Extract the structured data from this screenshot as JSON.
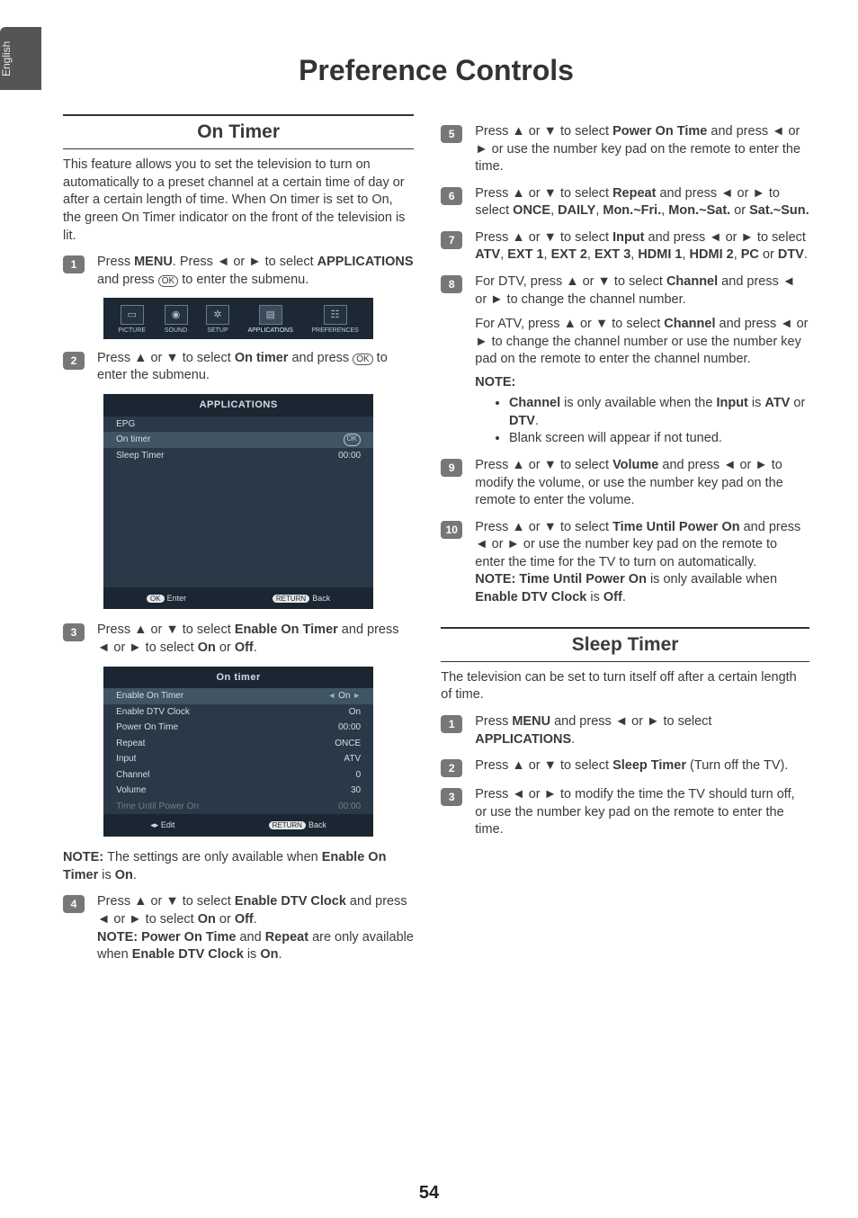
{
  "sideTab": "English",
  "pageTitle": "Preference Controls",
  "pageNumber": "54",
  "left": {
    "section": "On Timer",
    "intro": "This feature allows you to set the television to turn on automatically to a preset channel at a certain time of day or after a certain length of time. When On timer is set to On, the green On Timer indicator on the front of the television is lit.",
    "step1": {
      "pre": "Press ",
      "b1": "MENU",
      "mid1": ". Press ◄ or ► to select ",
      "b2": "APPLICATIONS",
      "mid2": " and press ",
      "ok": "OK",
      "post": " to enter the submenu."
    },
    "menubar": {
      "items": [
        "PICTURE",
        "SOUND",
        "SETUP",
        "APPLICATIONS",
        "PREFERENCES"
      ],
      "glyphs": [
        "▭",
        "◉",
        "✲",
        "▤",
        "☷"
      ]
    },
    "step2": {
      "pre": "Press ▲ or ▼ to select ",
      "b1": "On timer",
      "mid": " and press ",
      "ok": "OK",
      "post": " to enter the submenu."
    },
    "osd1": {
      "title": "APPLICATIONS",
      "rows": [
        {
          "k": "EPG",
          "v": ""
        },
        {
          "k": "On timer",
          "v": "OK",
          "sel": true
        },
        {
          "k": "Sleep Timer",
          "v": "00:00"
        }
      ],
      "footL": "Enter",
      "footLBtn": "OK",
      "footR": "Back",
      "footRBtn": "RETURN"
    },
    "step3": {
      "pre": "Press ▲ or ▼ to select ",
      "b1": "Enable On Timer",
      "mid": " and press ◄ or ► to select ",
      "b2": "On",
      "or": " or ",
      "b3": "Off",
      "post": "."
    },
    "osd2": {
      "title": "On timer",
      "rows": [
        {
          "k": "Enable On Timer",
          "v": "On",
          "sel": true,
          "arrows": true
        },
        {
          "k": "Enable DTV Clock",
          "v": "On"
        },
        {
          "k": "Power On Time",
          "v": "00:00"
        },
        {
          "k": "Repeat",
          "v": "ONCE"
        },
        {
          "k": "Input",
          "v": "ATV"
        },
        {
          "k": "Channel",
          "v": "0"
        },
        {
          "k": "Volume",
          "v": "30"
        },
        {
          "k": "Time Until Power On",
          "v": "00:00",
          "dim": true
        }
      ],
      "footL": "Edit",
      "footLIcon": "◂▸",
      "footR": "Back",
      "footRBtn": "RETURN"
    },
    "note3": {
      "head": "NOTE: ",
      "pre": "The settings are only available when ",
      "b": "Enable On Timer",
      "mid": " is ",
      "b2": "On",
      "post": "."
    },
    "step4": {
      "line1": {
        "pre": "Press ▲ or ▼ to select ",
        "b1": "Enable DTV Clock",
        "mid": " and press ◄ or ► to select ",
        "b2": "On",
        "or": " or ",
        "b3": "Off",
        "post": "."
      },
      "line2": {
        "head": "NOTE: ",
        "b1": "Power On Time",
        "and": " and ",
        "b2": "Repeat",
        "mid": " are only available when ",
        "b3": "Enable DTV Clock",
        "is": " is ",
        "b4": "On",
        "post": "."
      }
    }
  },
  "right": {
    "step5": {
      "pre": "Press ▲ or ▼ to select ",
      "b": "Power On Time",
      "post": " and press ◄ or ► or use the number key pad on the remote to enter the time."
    },
    "step6": {
      "pre": "Press ▲ or ▼ to select ",
      "b1": "Repeat",
      "mid": " and press ◄ or ► to select ",
      "b2": "ONCE",
      "c": ", ",
      "b3": "DAILY",
      "c2": ", ",
      "b4": "Mon.~Fri.",
      "c3": ", ",
      "b5": "Mon.~Sat.",
      "or": " or ",
      "b6": "Sat.~Sun."
    },
    "step7": {
      "pre": "Press ▲ or ▼ to select ",
      "b1": "Input",
      "mid": " and press ◄ or ► to select ",
      "b2": "ATV",
      "c": ", ",
      "b3": "EXT 1",
      "c2": ", ",
      "b4": "EXT 2",
      "c3": ", ",
      "b5": "EXT 3",
      "c4": ", ",
      "b6": "HDMI 1",
      "c5": ", ",
      "b7": "HDMI 2",
      "c6": ", ",
      "b8": "PC",
      "or": " or ",
      "b9": "DTV",
      "post": "."
    },
    "step8": {
      "p1": {
        "pre": "For DTV, press ▲ or ▼ to select ",
        "b": "Channel",
        "post": " and press ◄ or ► to change the channel number."
      },
      "p2": {
        "pre": "For ATV, press ▲ or ▼ to select ",
        "b": "Channel",
        "post": " and press ◄ or ► to change the channel number or use the number key pad on the remote to enter the channel number."
      },
      "noteHead": "NOTE:",
      "bullets": [
        {
          "b1": "Channel",
          "mid": " is only available when the ",
          "b2": "Input",
          "mid2": " is ",
          "b3": "ATV",
          "or": " or ",
          "b4": "DTV",
          "post": "."
        },
        {
          "txt": "Blank screen will appear if not tuned."
        }
      ]
    },
    "step9": {
      "pre": "Press ▲ or ▼ to select ",
      "b": "Volume",
      "post": " and press ◄ or ► to modify the volume, or use the number key pad on the remote to enter the volume."
    },
    "step10": {
      "p1": {
        "pre": "Press ▲ or ▼ to select ",
        "b": "Time Until Power On",
        "post": " and press ◄ or ► or use the number key pad on the remote to enter the time for the TV to turn on automatically."
      },
      "note": {
        "head": "NOTE: ",
        "b1": "Time Until Power On",
        "mid": " is only available when ",
        "b2": "Enable DTV Clock",
        "is": " is ",
        "b3": "Off",
        "post": "."
      }
    },
    "sleep": {
      "section": "Sleep Timer",
      "intro": "The television can be set to turn itself off after a certain length of time.",
      "s1": {
        "pre": "Press ",
        "b1": "MENU",
        "mid": " and press ◄ or ► to select ",
        "b2": "APPLICATIONS",
        "post": "."
      },
      "s2": {
        "pre": "Press ▲ or ▼ to select ",
        "b": "Sleep Timer",
        "post": " (Turn off the TV)."
      },
      "s3": {
        "txt": "Press ◄ or ► to modify the time the TV should turn off, or use the number key pad on the remote to enter the time."
      }
    }
  }
}
